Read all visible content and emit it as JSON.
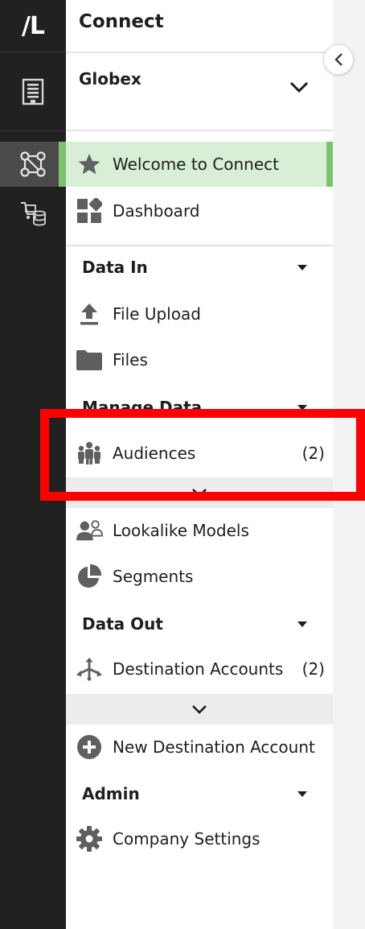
{
  "brand": {
    "logo_text": "/L"
  },
  "header": {
    "title": "Connect"
  },
  "org": {
    "name": "Globex"
  },
  "nav": {
    "welcome": {
      "label": "Welcome to Connect",
      "icon": "star-icon"
    },
    "dashboard": {
      "label": "Dashboard",
      "icon": "dashboard-icon"
    },
    "sections": {
      "data_in": "Data In",
      "manage_data": "Manage Data",
      "data_out": "Data Out",
      "admin": "Admin"
    },
    "file_upload": {
      "label": "File Upload",
      "icon": "upload-icon"
    },
    "files": {
      "label": "Files",
      "icon": "folder-icon"
    },
    "audiences": {
      "label": "Audiences",
      "count": "(2)",
      "icon": "people-icon"
    },
    "lookalike": {
      "label": "Lookalike Models",
      "icon": "lookalike-icon"
    },
    "segments": {
      "label": "Segments",
      "icon": "pie-icon"
    },
    "destination_accounts": {
      "label": "Destination Accounts",
      "count": "(2)",
      "icon": "destination-icon"
    },
    "new_destination": {
      "label": "New Destination Account",
      "icon": "plus-circle-icon"
    },
    "company_settings": {
      "label": "Company Settings",
      "icon": "gear-icon"
    }
  },
  "colors": {
    "rail": "#212121",
    "welcome_bg": "#d8eed6",
    "welcome_accent": "#7ac46e",
    "highlight": "#ff0000"
  }
}
